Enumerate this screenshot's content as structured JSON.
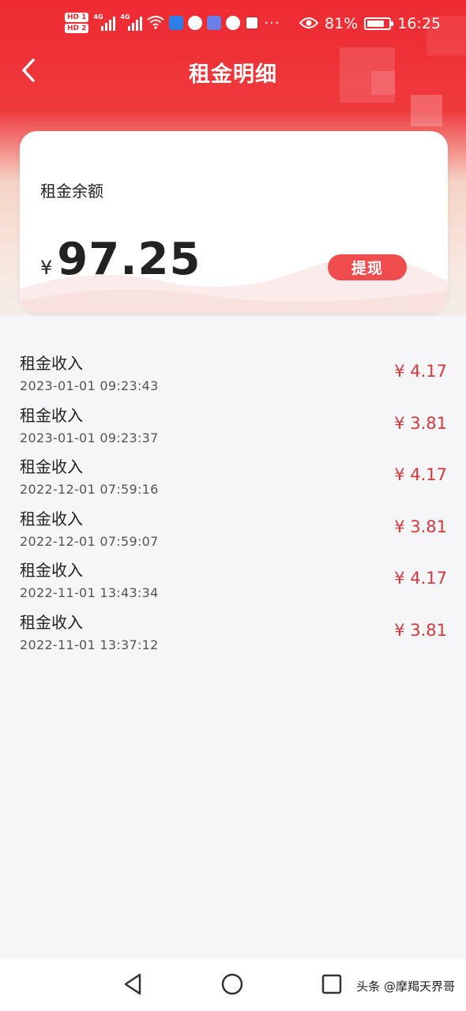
{
  "status_bar": {
    "sim1": "HD 1",
    "sim2": "HD 2",
    "net1": "4G",
    "net2": "4G",
    "battery_percent": "81%",
    "battery_level": 0.81,
    "time": "16:25",
    "more": "···",
    "icons": [
      "wifi-icon",
      "shield-app-icon",
      "heart-app-icon",
      "music-app-icon",
      "heart-app-icon",
      "news-app-icon",
      "eye-icon",
      "battery-icon"
    ]
  },
  "header": {
    "title": "租金明细",
    "back_icon": "chevron-left-icon"
  },
  "balance_card": {
    "label": "租金余额",
    "currency": "¥",
    "amount": "97.25",
    "withdraw_label": "提现"
  },
  "transactions": [
    {
      "title": "租金收入",
      "time": "2023-01-01 09:23:43",
      "amount": "¥ 4.17"
    },
    {
      "title": "租金收入",
      "time": "2023-01-01 09:23:37",
      "amount": "¥ 3.81"
    },
    {
      "title": "租金收入",
      "time": "2022-12-01 07:59:16",
      "amount": "¥ 4.17"
    },
    {
      "title": "租金收入",
      "time": "2022-12-01 07:59:07",
      "amount": "¥ 3.81"
    },
    {
      "title": "租金收入",
      "time": "2022-11-01 13:43:34",
      "amount": "¥ 4.17"
    },
    {
      "title": "租金收入",
      "time": "2022-11-01 13:37:12",
      "amount": "¥ 3.81"
    }
  ],
  "nav_bar": {
    "icons": [
      "back-triangle-icon",
      "home-circle-icon",
      "recent-square-icon"
    ]
  },
  "watermark": "头条 @摩羯天界哥",
  "colors": {
    "header_red": "#ee2a32",
    "accent_red": "#ef4c4e",
    "amount_red": "#d6383c",
    "background": "#f6f5f7"
  }
}
